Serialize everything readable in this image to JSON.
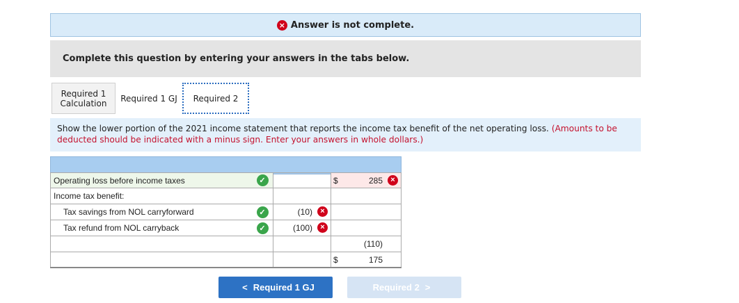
{
  "banner": {
    "text": "Answer is not complete.",
    "icon": "x-circle-icon",
    "icon_glyph": "×"
  },
  "instruction": "Complete this question by entering your answers in the tabs below.",
  "tabs": [
    {
      "label_line1": "Required 1",
      "label_line2": "Calculation"
    },
    {
      "label": "Required 1 GJ"
    },
    {
      "label": "Required 2"
    }
  ],
  "question": {
    "text": "Show the lower portion of the 2021 income statement that reports the income tax benefit of the net operating loss.",
    "note": "(Amounts to be deducted should be indicated with a minus sign. Enter your answers in whole dollars.)"
  },
  "table": {
    "rows": [
      {
        "label": "Operating loss before income taxes",
        "col1": "",
        "col2": "285",
        "col2_dollar": "$"
      },
      {
        "label": "Income tax benefit:",
        "col1": "",
        "col2": ""
      },
      {
        "label": "Tax savings from NOL carryforward",
        "col1": "(10)",
        "col2": ""
      },
      {
        "label": "Tax refund from NOL carryback",
        "col1": "(100)",
        "col2": ""
      },
      {
        "label": "",
        "col1": "",
        "col2": "(110)"
      },
      {
        "label": "",
        "col1": "",
        "col2": "175",
        "col2_dollar": "$"
      }
    ]
  },
  "glyphs": {
    "check": "✓",
    "x": "×"
  },
  "nav": {
    "prev_label": "Required 1 GJ",
    "prev_chevron": "<",
    "next_label": "Required 2",
    "next_chevron": ">"
  },
  "colors": {
    "error_red": "#d0021b",
    "correct_green": "#3aa54b",
    "primary_blue": "#2d72c4"
  }
}
